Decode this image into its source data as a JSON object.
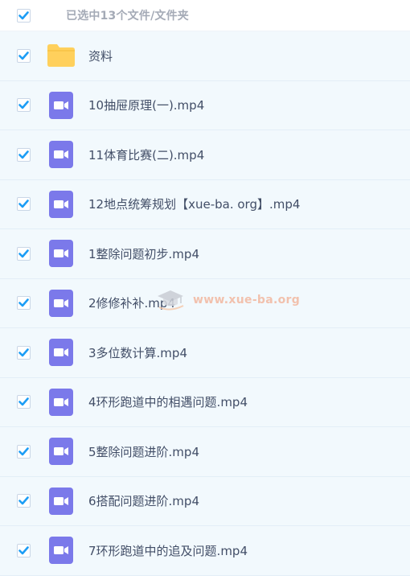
{
  "header": {
    "selection_summary": "已选中13个文件/文件夹",
    "select_all_checked": true
  },
  "colors": {
    "check_accent": "#1c9df5",
    "video_icon": "#7b79ea",
    "folder_icon": "#ffd05c",
    "row_bg": "#f2f9fd",
    "watermark": "#f3b8a0"
  },
  "files": [
    {
      "name": "资料",
      "type": "folder",
      "checked": true
    },
    {
      "name": "10抽屉原理(一).mp4",
      "type": "video",
      "checked": true
    },
    {
      "name": "11体育比赛(二).mp4",
      "type": "video",
      "checked": true
    },
    {
      "name": "12地点统筹规划【xue-ba. org】.mp4",
      "type": "video",
      "checked": true
    },
    {
      "name": "1整除问题初步.mp4",
      "type": "video",
      "checked": true
    },
    {
      "name": "2修修补补.mp4",
      "type": "video",
      "checked": true
    },
    {
      "name": "3多位数计算.mp4",
      "type": "video",
      "checked": true
    },
    {
      "name": "4环形跑道中的相遇问题.mp4",
      "type": "video",
      "checked": true
    },
    {
      "name": "5整除问题进阶.mp4",
      "type": "video",
      "checked": true
    },
    {
      "name": "6搭配问题进阶.mp4",
      "type": "video",
      "checked": true
    },
    {
      "name": "7环形跑道中的追及问题.mp4",
      "type": "video",
      "checked": true
    }
  ],
  "watermark": {
    "text": "www.xue-ba.org",
    "icon": "graduation-cap-icon"
  }
}
